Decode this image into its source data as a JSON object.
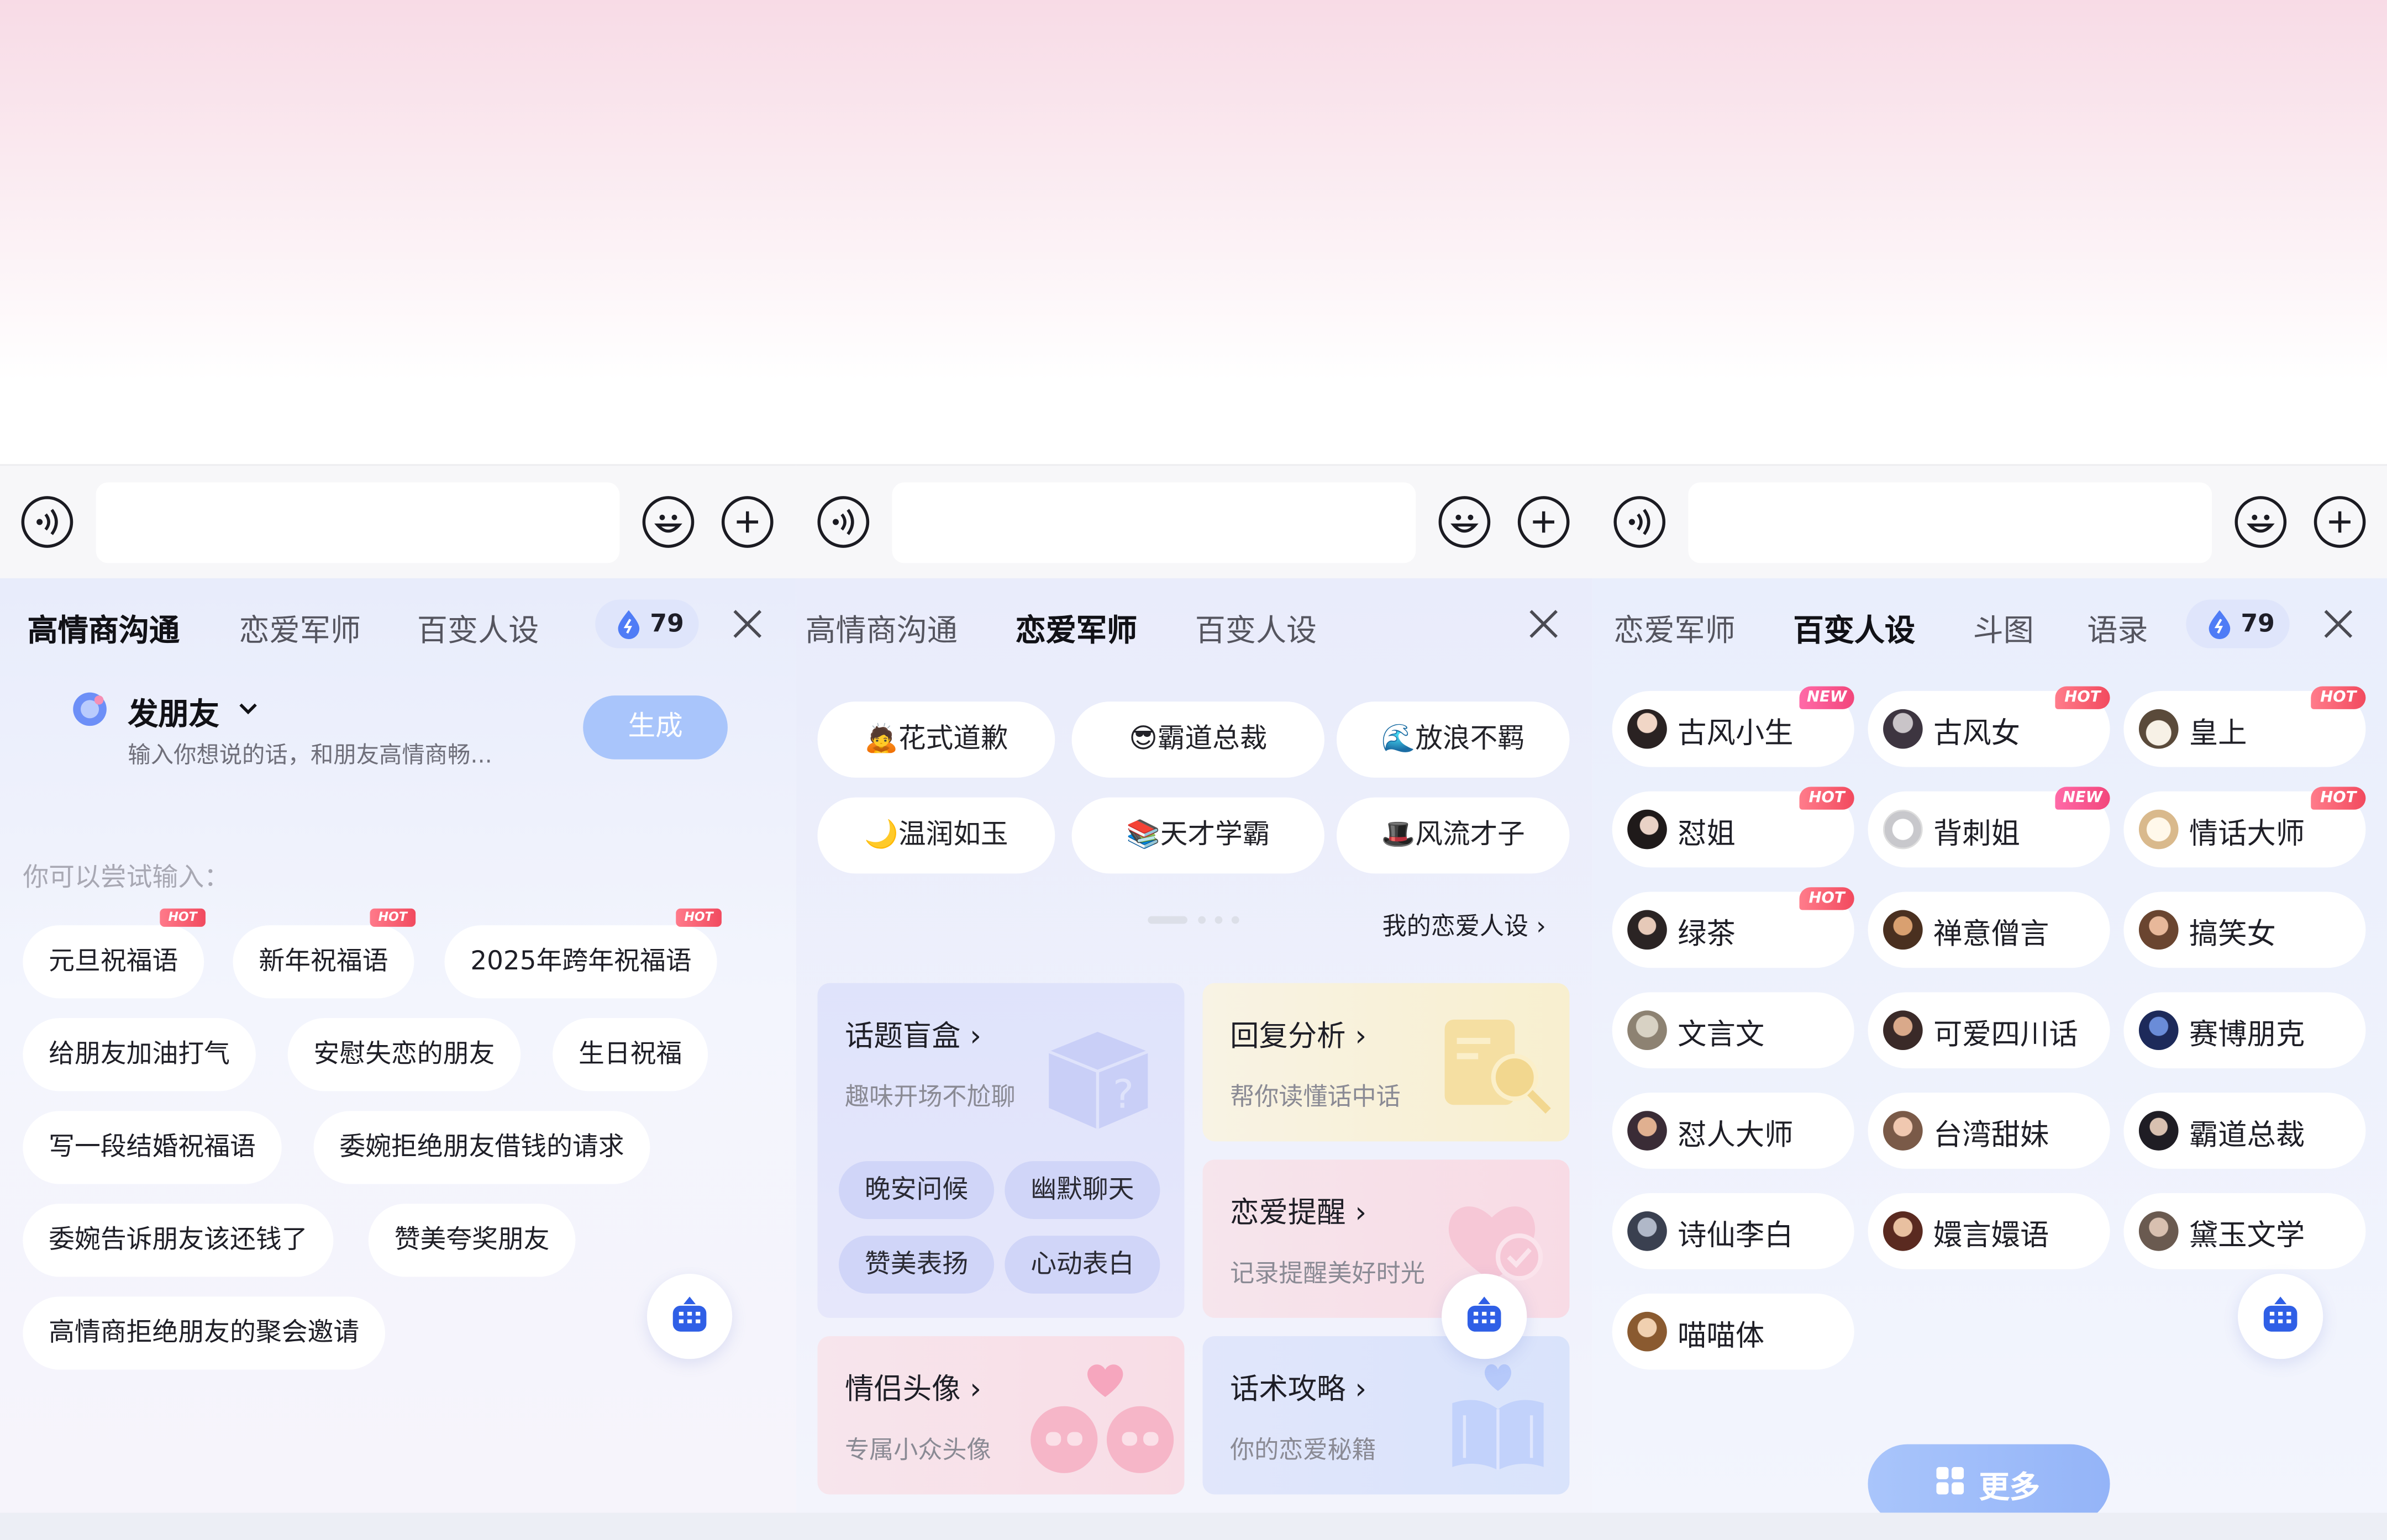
{
  "colors": {
    "accent": "#3f6bf4",
    "hot": "#f14a5f",
    "new": "#f2467b",
    "generate_button": "#a9c5fb",
    "more_button": "#9fbcf9"
  },
  "icons": {
    "voice": "voice-wave-icon",
    "emoji": "smiley-icon",
    "plus": "plus-circle-icon",
    "close": "close-x-icon",
    "drop": "water-drop-icon",
    "keyboard": "keyboard-icon",
    "chevron": "chevron-right-icon"
  },
  "panels": {
    "p1": {
      "tabs": [
        "高情商沟通",
        "恋爱军师",
        "百变人设"
      ],
      "credits": "79",
      "mode_title": "发朋友",
      "input_hint": "输入你想说的话，和朋友高情商畅...",
      "generate": "生成",
      "try_label": "你可以尝试输入：",
      "hot_tag": "HOT",
      "suggestions": [
        "元旦祝福语",
        "新年祝福语",
        "2025年跨年祝福语",
        "给朋友加油打气",
        "安慰失恋的朋友",
        "生日祝福",
        "写一段结婚祝福语",
        "委婉拒绝朋友借钱的请求",
        "委婉告诉朋友该还钱了",
        "赞美夸奖朋友",
        "高情商拒绝朋友的聚会邀请"
      ]
    },
    "p2": {
      "tabs": [
        "高情商沟通",
        "恋爱军师",
        "百变人设"
      ],
      "personas": [
        "🙇花式道歉",
        "😎霸道总裁",
        "🌊放浪不羁",
        "🌙温润如玉",
        "📚天才学霸",
        "🎩风流才子"
      ],
      "my_persona_link": "我的恋爱人设",
      "cards": [
        {
          "title": "话题盲盒",
          "sub": "趣味开场不尬聊"
        },
        {
          "title": "回复分析",
          "sub": "帮你读懂话中话"
        },
        {
          "title": "恋爱提醒",
          "sub": "记录提醒美好时光"
        },
        {
          "title": "情侣头像",
          "sub": "专属小众头像"
        },
        {
          "title": "话术攻略",
          "sub": "你的恋爱秘籍"
        }
      ],
      "topic_tags": [
        "晚安问候",
        "幽默聊天",
        "赞美表扬",
        "心动表白"
      ]
    },
    "p3": {
      "tabs": [
        "恋爱军师",
        "百变人设",
        "斗图",
        "语录"
      ],
      "credits": "79",
      "hot_tag": "HOT",
      "new_tag": "NEW",
      "characters": [
        "古风小生",
        "古风女",
        "皇上",
        "怼姐",
        "背刺姐",
        "情话大师",
        "绿茶",
        "禅意僧言",
        "搞笑女",
        "文言文",
        "可爱四川话",
        "赛博朋克",
        "怼人大师",
        "台湾甜妹",
        "霸道总裁",
        "诗仙李白",
        "嬛言嬛语",
        "黛玉文学",
        "喵喵体"
      ],
      "more_button": "更多"
    }
  }
}
